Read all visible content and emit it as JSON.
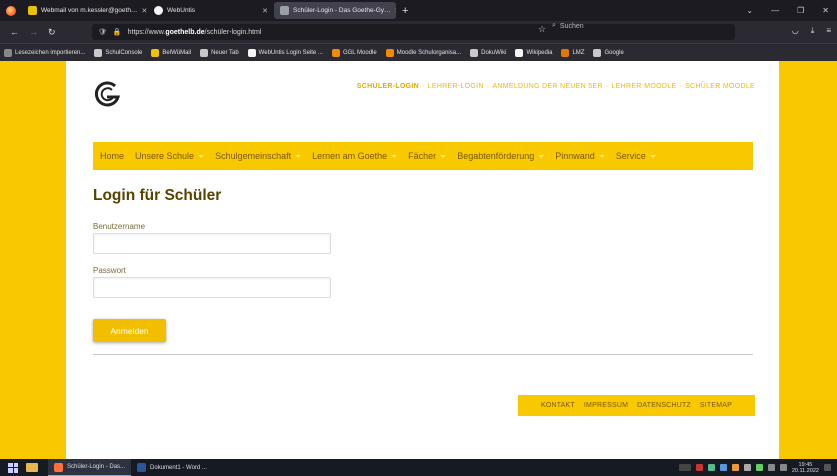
{
  "browser": {
    "tabs": [
      {
        "title": "Webmail von m.kessler@goeth…",
        "fav_color": "#e9c200"
      },
      {
        "title": "WebUntis",
        "fav_color": "#f4f4f4"
      },
      {
        "title": "Schüler-Login - Das Goethe-Gy…",
        "fav_color": "#9aa0a6"
      }
    ],
    "url_prefix": "https://www.",
    "url_domain": "goethelb.de",
    "url_path": "/schüler-login.html",
    "search_placeholder": "Suchen",
    "bookmarks": [
      {
        "label": "Lesezeichen importieren...",
        "color": "#888"
      },
      {
        "label": "SchulConsole",
        "color": "#c9c9c9"
      },
      {
        "label": "BelWüMail",
        "color": "#f2c200"
      },
      {
        "label": "Neuer Tab",
        "color": "#c9c9c9"
      },
      {
        "label": "WebUntis Login Seite ...",
        "color": "#f4f4f4"
      },
      {
        "label": "GGL Moodle",
        "color": "#f08a00"
      },
      {
        "label": "Moodle Schulorganisa...",
        "color": "#f08a00"
      },
      {
        "label": "DokuWiki",
        "color": "#c9c9c9"
      },
      {
        "label": "Wikipedia",
        "color": "#f4f4f4"
      },
      {
        "label": "LMZ",
        "color": "#e07a00"
      },
      {
        "label": "Google",
        "color": "#c9c9c9"
      }
    ]
  },
  "site": {
    "top_links": [
      "SCHÜLER-LOGIN",
      "LEHRER-LOGIN",
      "ANMELDUNG DER NEUEN 5ER",
      "LEHRER-MOODLE",
      "SCHÜLER MOODLE"
    ],
    "main_nav": [
      {
        "label": "Home",
        "caret": false
      },
      {
        "label": "Unsere Schule",
        "caret": true
      },
      {
        "label": "Schulgemeinschaft",
        "caret": true
      },
      {
        "label": "Lernen am Goethe",
        "caret": true
      },
      {
        "label": "Fächer",
        "caret": true
      },
      {
        "label": "Begabtenförderung",
        "caret": true
      },
      {
        "label": "Pinnwand",
        "caret": true
      },
      {
        "label": "Service",
        "caret": true
      }
    ],
    "login_title": "Login für Schüler",
    "username_label": "Benutzername",
    "password_label": "Passwort",
    "submit_label": "Anmelden",
    "footer_links": [
      "KONTAKT",
      "IMPRESSUM",
      "DATENSCHUTZ",
      "SITEMAP"
    ],
    "accent": "#f9c900"
  },
  "taskbar": {
    "items": [
      {
        "label": "Schüler-Login - Das...",
        "color": "#ff7139",
        "active": true
      },
      {
        "label": "Dokument1 - Word ...",
        "color": "#2b579a",
        "active": false
      }
    ],
    "time": "19:45",
    "date": "20.11.2022"
  }
}
